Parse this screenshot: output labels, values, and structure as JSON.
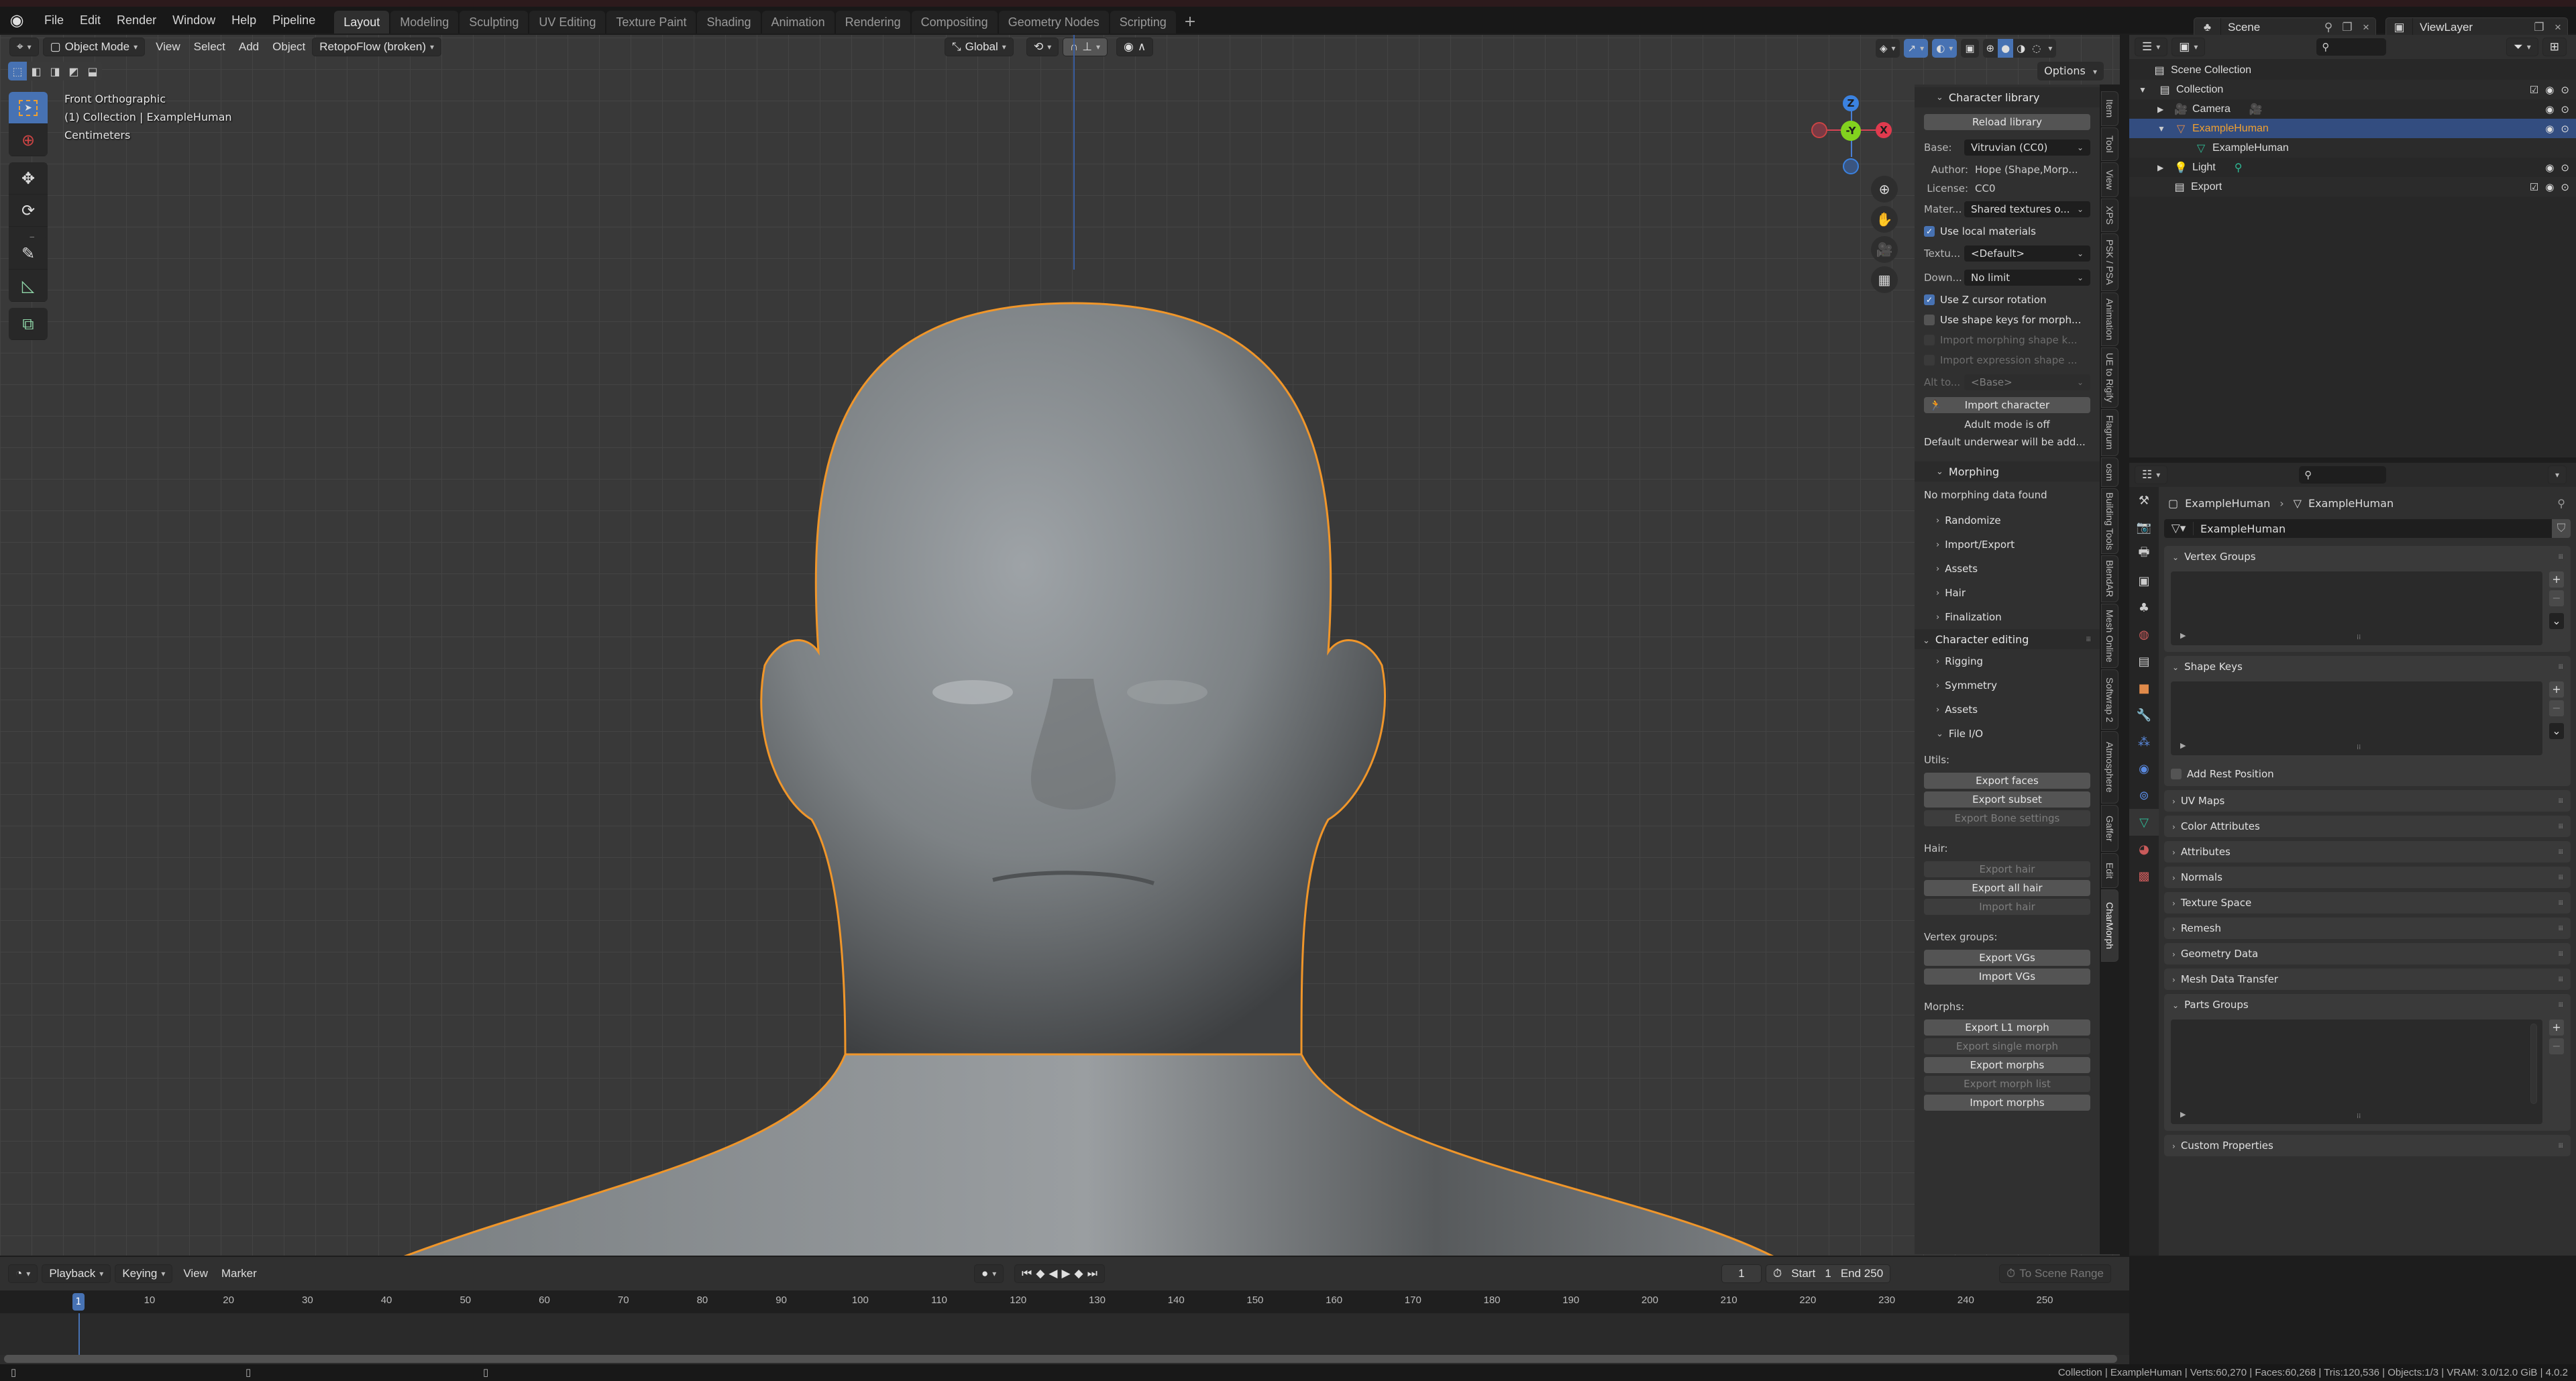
{
  "menubar": {
    "items": [
      "File",
      "Edit",
      "Render",
      "Window",
      "Help",
      "Pipeline"
    ],
    "workspaces": [
      "Layout",
      "Modeling",
      "Sculpting",
      "UV Editing",
      "Texture Paint",
      "Shading",
      "Animation",
      "Rendering",
      "Compositing",
      "Geometry Nodes",
      "Scripting"
    ],
    "active_workspace": "Layout",
    "add_label": "+",
    "scene": "Scene",
    "view_layer": "ViewLayer"
  },
  "viewport": {
    "mode": "Object Mode",
    "menus": [
      "View",
      "Select",
      "Add",
      "Object"
    ],
    "addon_menu": "RetopoFlow (broken)",
    "orientation": "Global",
    "options_label": "Options",
    "info": {
      "view_name": "Front Orthographic",
      "collection_line": "(1) Collection | ExampleHuman",
      "units": "Centimeters"
    },
    "gizmo": {
      "z": "Z",
      "y": "-Y",
      "x": "X"
    },
    "accent_color": "#4772b3",
    "selection_outline_color": "#f0962a"
  },
  "npanel": {
    "character_library": {
      "title": "Character library",
      "reload_btn": "Reload library",
      "base_label": "Base:",
      "base_value": "Vitruvian (CC0)",
      "author_label": "Author:",
      "author_value": "Hope (Shape,Morp...",
      "license_label": "License:",
      "license_value": "CC0",
      "material_label": "Mater...",
      "material_value": "Shared textures o...",
      "use_local_materials": "Use local materials",
      "texture_label": "Textu...",
      "texture_value": "<Default>",
      "download_label": "Down...",
      "download_value": "No limit",
      "use_z_cursor": "Use Z cursor rotation",
      "use_shape_keys": "Use shape keys for morph...",
      "import_morphing": "Import morphing shape k...",
      "import_expression": "Import expression shape ...",
      "alt_label": "Alt to...",
      "alt_value": "<Base>",
      "import_btn": "Import character",
      "adult_mode": "Adult mode is off",
      "underwear": "Default underwear will be add..."
    },
    "morphing": {
      "title": "Morphing",
      "no_data": "No morphing data found",
      "subpanels": [
        "Randomize",
        "Import/Export",
        "Assets",
        "Hair",
        "Finalization"
      ]
    },
    "character_editing": {
      "title": "Character editing",
      "subpanels": [
        "Rigging",
        "Symmetry",
        "Assets"
      ],
      "file_io": "File I/O",
      "utils_label": "Utils:",
      "utils_buttons": [
        {
          "label": "Export faces",
          "enabled": true
        },
        {
          "label": "Export subset",
          "enabled": true
        },
        {
          "label": "Export Bone settings",
          "enabled": false
        }
      ],
      "hair_label": "Hair:",
      "hair_buttons": [
        {
          "label": "Export hair",
          "enabled": false
        },
        {
          "label": "Export all hair",
          "enabled": true
        },
        {
          "label": "Import hair",
          "enabled": false
        }
      ],
      "vg_label": "Vertex groups:",
      "vg_buttons": [
        {
          "label": "Export VGs",
          "enabled": true
        },
        {
          "label": "Import VGs",
          "enabled": true
        }
      ],
      "morphs_label": "Morphs:",
      "morph_buttons": [
        {
          "label": "Export L1 morph",
          "enabled": true
        },
        {
          "label": "Export single morph",
          "enabled": false
        },
        {
          "label": "Export morphs",
          "enabled": true
        },
        {
          "label": "Export morph list",
          "enabled": false
        },
        {
          "label": "Import morphs",
          "enabled": true
        }
      ]
    },
    "side_tabs": [
      "Item",
      "Tool",
      "View",
      "XPS",
      "PSK / PSA",
      "Animation",
      "UE to Rigify",
      "Flagrum",
      "osm",
      "Building Tools",
      "BlendAR",
      "Mesh Online",
      "Softwrap 2",
      "Atmosphere",
      "Gaffer",
      "Edit",
      "CharMorph"
    ],
    "active_tab": "CharMorph"
  },
  "outliner": {
    "rows": [
      {
        "label": "Scene Collection",
        "depth": 0,
        "icon": "collection-icon"
      },
      {
        "label": "Collection",
        "depth": 1,
        "icon": "collection-icon",
        "checkbox": true
      },
      {
        "label": "Camera",
        "depth": 2,
        "icon": "camera-icon"
      },
      {
        "label": "ExampleHuman",
        "depth": 2,
        "icon": "mesh-object-icon",
        "selected": true
      },
      {
        "label": "ExampleHuman",
        "depth": 3,
        "icon": "mesh-data-icon"
      },
      {
        "label": "Light",
        "depth": 2,
        "icon": "light-icon"
      },
      {
        "label": "Export",
        "depth": 1,
        "icon": "collection-icon",
        "checkbox": true
      }
    ]
  },
  "properties": {
    "breadcrumb_object": "ExampleHuman",
    "breadcrumb_data": "ExampleHuman",
    "data_name": "ExampleHuman",
    "panels": {
      "vertex_groups": "Vertex Groups",
      "shape_keys": "Shape Keys",
      "add_rest_position": "Add Rest Position",
      "collapsed": [
        "UV Maps",
        "Color Attributes",
        "Attributes",
        "Normals",
        "Texture Space",
        "Remesh",
        "Geometry Data",
        "Mesh Data Transfer"
      ],
      "parts_groups": "Parts Groups",
      "custom_properties": "Custom Properties"
    }
  },
  "timeline": {
    "menus": [
      "Playback",
      "Keying",
      "View",
      "Marker"
    ],
    "current_frame": "1",
    "start_label": "Start",
    "start": "1",
    "end_label": "End",
    "end": "250",
    "scene_range": "To Scene Range",
    "ticks": [
      "10",
      "20",
      "30",
      "40",
      "50",
      "60",
      "70",
      "80",
      "90",
      "100",
      "110",
      "120",
      "130",
      "140",
      "150",
      "160",
      "170",
      "180",
      "190",
      "200",
      "210",
      "220",
      "230",
      "240",
      "250"
    ]
  },
  "statusbar": {
    "text": "Collection | ExampleHuman | Verts:60,270 | Faces:60,268 | Tris:120,536 | Objects:1/3 | VRAM: 3.0/12.0 GiB | 4.0.2"
  }
}
